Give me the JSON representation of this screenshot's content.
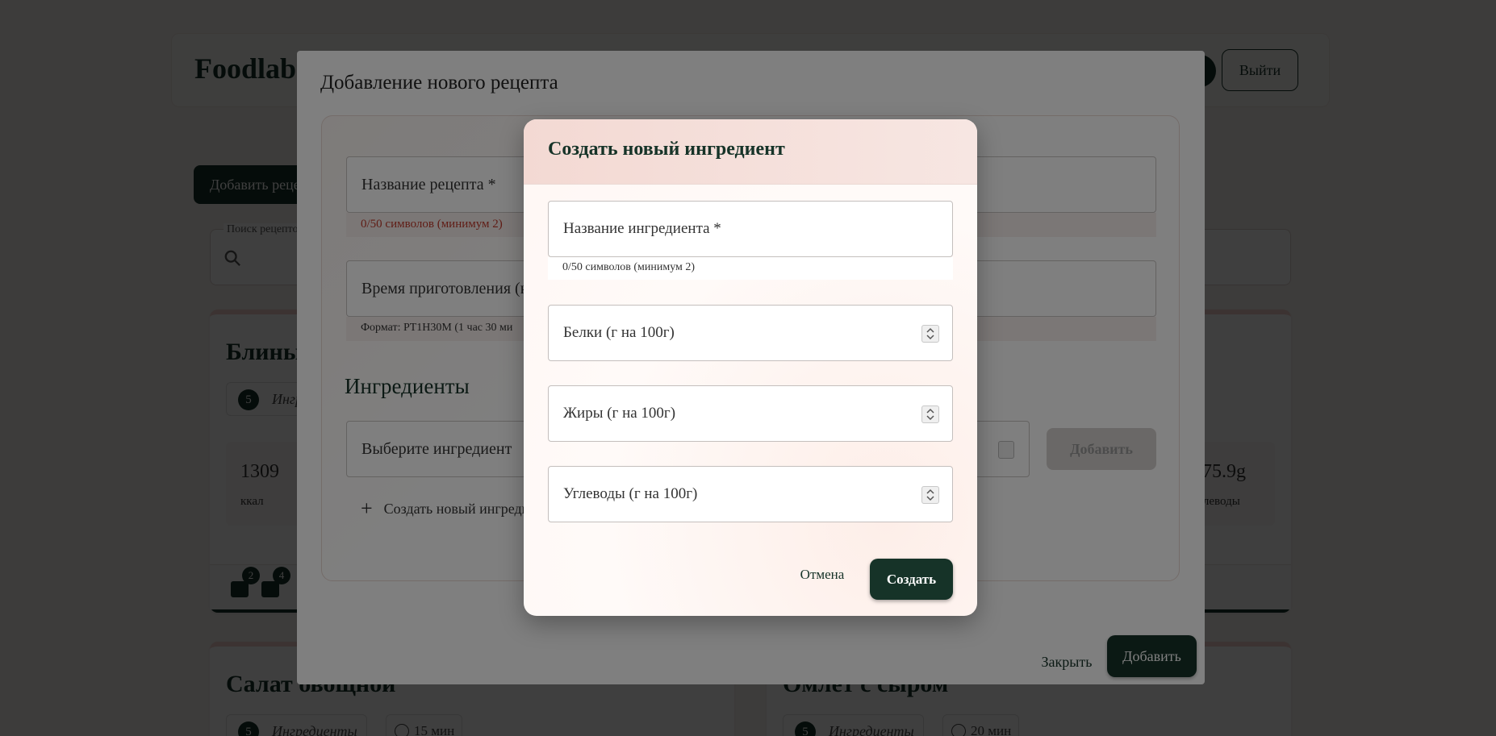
{
  "header": {
    "logo": "Foodlab",
    "logout_label": "Выйти"
  },
  "main": {
    "add_recipe_label": "Добавить рецепт",
    "search_label": "Поиск рецептов"
  },
  "cards": [
    {
      "title": "Блины",
      "ingredients_count": "5",
      "ingredients_label": "Ингредиенты",
      "calories": "1309",
      "calories_unit": "ккал",
      "carbs": "175.9g",
      "carbs_label": "углеводы",
      "comments_count": "2",
      "bookmarks_count": "4"
    },
    {
      "title": "Салат овощной",
      "ingredients_count": "5",
      "ingredients_label": "Ингредиенты",
      "time": "15 мин"
    },
    {
      "title": "Омлет с сыром",
      "ingredients_count": "5",
      "ingredients_label": "Ингредиенты",
      "time": "20 мин"
    }
  ],
  "recipe_modal": {
    "title": "Добавление нового рецепта",
    "name_field_label": "Название рецепта *",
    "name_helper": "0/50 символов (минимум 2)",
    "time_field_label": "Время приготовления (н",
    "time_helper": "Формат: PT1H30M (1 час 30 ми",
    "ingredients_heading": "Ингредиенты",
    "ingredient_select_placeholder": "Выберите ингредиент",
    "add_ingredient_label": "Добавить",
    "create_new_ingredient_label": "Создать новый ингредиент",
    "close_label": "Закрыть",
    "submit_label": "Добавить"
  },
  "ingredient_dialog": {
    "title": "Создать новый ингредиент",
    "name_label": "Название ингредиента *",
    "name_helper": "0/50 символов (минимум 2)",
    "protein_label": "Белки (г на 100г)",
    "fat_label": "Жиры (г на 100г)",
    "carbs_label": "Углеводы (г на 100г)",
    "cancel_label": "Отмена",
    "create_label": "Создать"
  },
  "colors": {
    "brand": "#163328",
    "accent_pink": "#f3d9d3",
    "error": "#c0392b"
  }
}
